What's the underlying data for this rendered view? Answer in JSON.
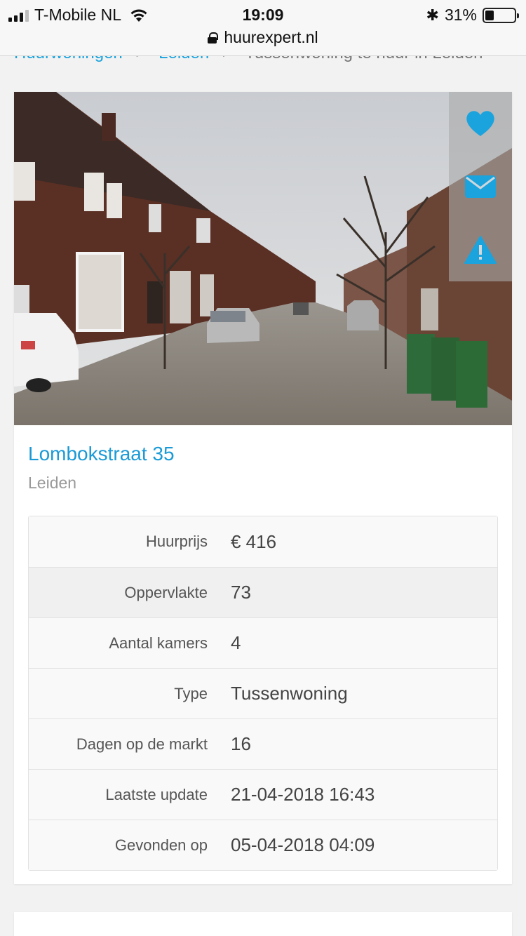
{
  "status_bar": {
    "carrier": "T-Mobile NL",
    "time": "19:09",
    "battery": "31%",
    "battery_level": 0.31,
    "url": "huurexpert.nl"
  },
  "breadcrumb": {
    "items": [
      "Huurwoningen",
      "Leiden",
      "Tussenwoning te huur in Leiden"
    ]
  },
  "listing": {
    "title": "Lombokstraat 35",
    "city": "Leiden",
    "actions": {
      "favorite_icon": "heart-icon",
      "contact_icon": "envelope-icon",
      "report_icon": "warning-icon"
    },
    "details": [
      {
        "label": "Huurprijs",
        "value": "€ 416"
      },
      {
        "label": "Oppervlakte",
        "value": "73"
      },
      {
        "label": "Aantal kamers",
        "value": "4"
      },
      {
        "label": "Type",
        "value": "Tussenwoning"
      },
      {
        "label": "Dagen op de markt",
        "value": "16"
      },
      {
        "label": "Laatste update",
        "value": "21-04-2018 16:43"
      },
      {
        "label": "Gevonden op",
        "value": "05-04-2018 04:09"
      }
    ]
  },
  "colors": {
    "accent": "#1aa3dd"
  }
}
